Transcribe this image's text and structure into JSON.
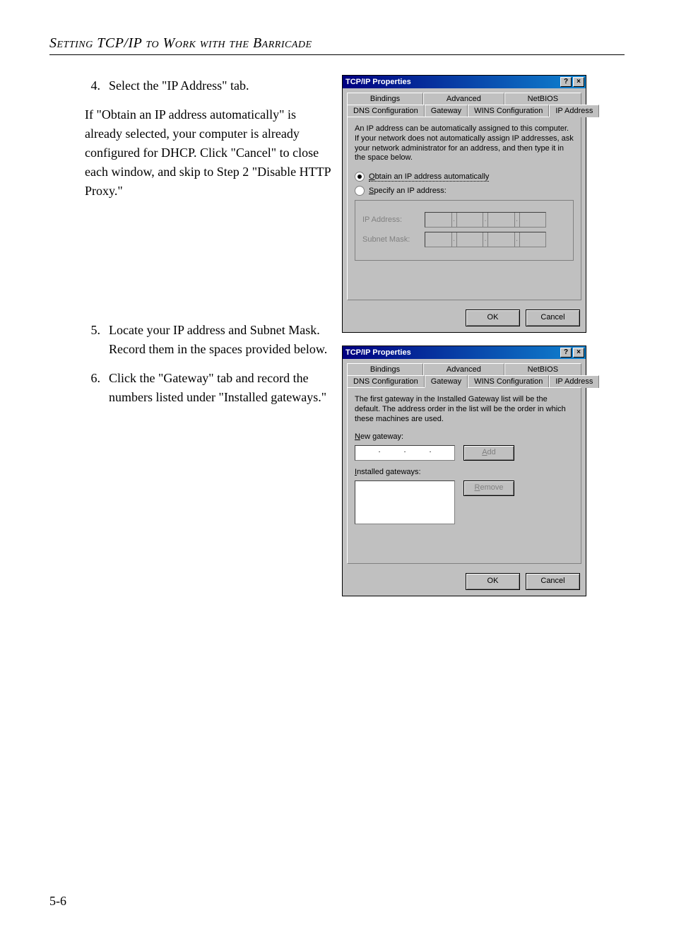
{
  "header": "Setting TCP/IP to Work with the Barricade",
  "page_number": "5-6",
  "step4": {
    "num": "4.",
    "text": "Select the \"IP Address\" tab."
  },
  "para4": "If \"Obtain an IP address automatically\" is already selected, your computer is already configured for DHCP. Click \"Cancel\" to close each window, and skip to Step 2 \"Disable HTTP Proxy.\"",
  "step5": {
    "num": "5.",
    "text": "Locate your IP address and Subnet Mask. Record them in the spaces provided below."
  },
  "step6": {
    "num": "6.",
    "text": "Click the \"Gateway\" tab and record the numbers listed under \"Installed gateways.\""
  },
  "dialog1": {
    "title": "TCP/IP Properties",
    "help": "?",
    "close": "×",
    "tabs_row1": {
      "bindings": "Bindings",
      "advanced": "Advanced",
      "netbios": "NetBIOS"
    },
    "tabs_row2": {
      "dns": "DNS Configuration",
      "gateway": "Gateway",
      "wins": "WINS Configuration",
      "ip": "IP Address"
    },
    "note": "An IP address can be automatically assigned to this computer. If your network does not automatically assign IP addresses, ask your network administrator for an address, and then type it in the space below.",
    "radio_obtain": "Obtain an IP address automatically",
    "radio_specify": "Specify an IP address:",
    "ip_label": "IP Address:",
    "mask_label": "Subnet Mask:",
    "ok": "OK",
    "cancel": "Cancel"
  },
  "dialog2": {
    "title": "TCP/IP Properties",
    "help": "?",
    "close": "×",
    "tabs_row1": {
      "bindings": "Bindings",
      "advanced": "Advanced",
      "netbios": "NetBIOS"
    },
    "tabs_row2": {
      "dns": "DNS Configuration",
      "gateway": "Gateway",
      "wins": "WINS Configuration",
      "ip": "IP Address"
    },
    "note": "The first gateway in the Installed Gateway list will be the default. The address order in the list will be the order in which these machines are used.",
    "new_gateway": "New gateway:",
    "add": "Add",
    "installed": "Installed gateways:",
    "remove": "Remove",
    "ok": "OK",
    "cancel": "Cancel"
  }
}
